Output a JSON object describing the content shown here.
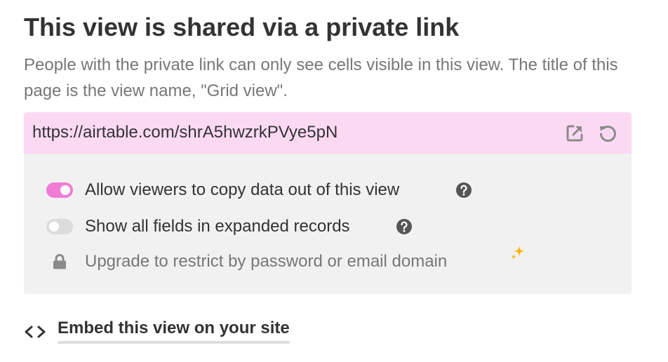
{
  "header": {
    "title": "This view is shared via a private link",
    "description": "People with the private link can only see cells visible in this view. The title of this page is the view name, \"Grid view\"."
  },
  "share_link": {
    "url": "https://airtable.com/shrA5hwzrkPVye5pN",
    "open_icon": "external-link-icon",
    "regenerate_icon": "refresh-icon",
    "background_color": "#fcd9f3"
  },
  "options": {
    "allow_copy": {
      "label": "Allow viewers to copy data out of this view",
      "enabled": true,
      "icon": "help-icon"
    },
    "show_all_fields": {
      "label": "Show all fields in expanded records",
      "enabled": false,
      "icon": "help-icon"
    },
    "restrict": {
      "label": "Upgrade to restrict by password or email domain",
      "lock_icon": "lock-icon",
      "upgrade_icon": "sparkle-icon"
    }
  },
  "embed": {
    "label": "Embed this view on your site",
    "icon": "code-brackets-icon"
  },
  "colors": {
    "toggle_on": "#f07cd6",
    "toggle_off": "#dcdcdc",
    "sparkle": "#fcb400",
    "panel": "#f1f1f1"
  }
}
